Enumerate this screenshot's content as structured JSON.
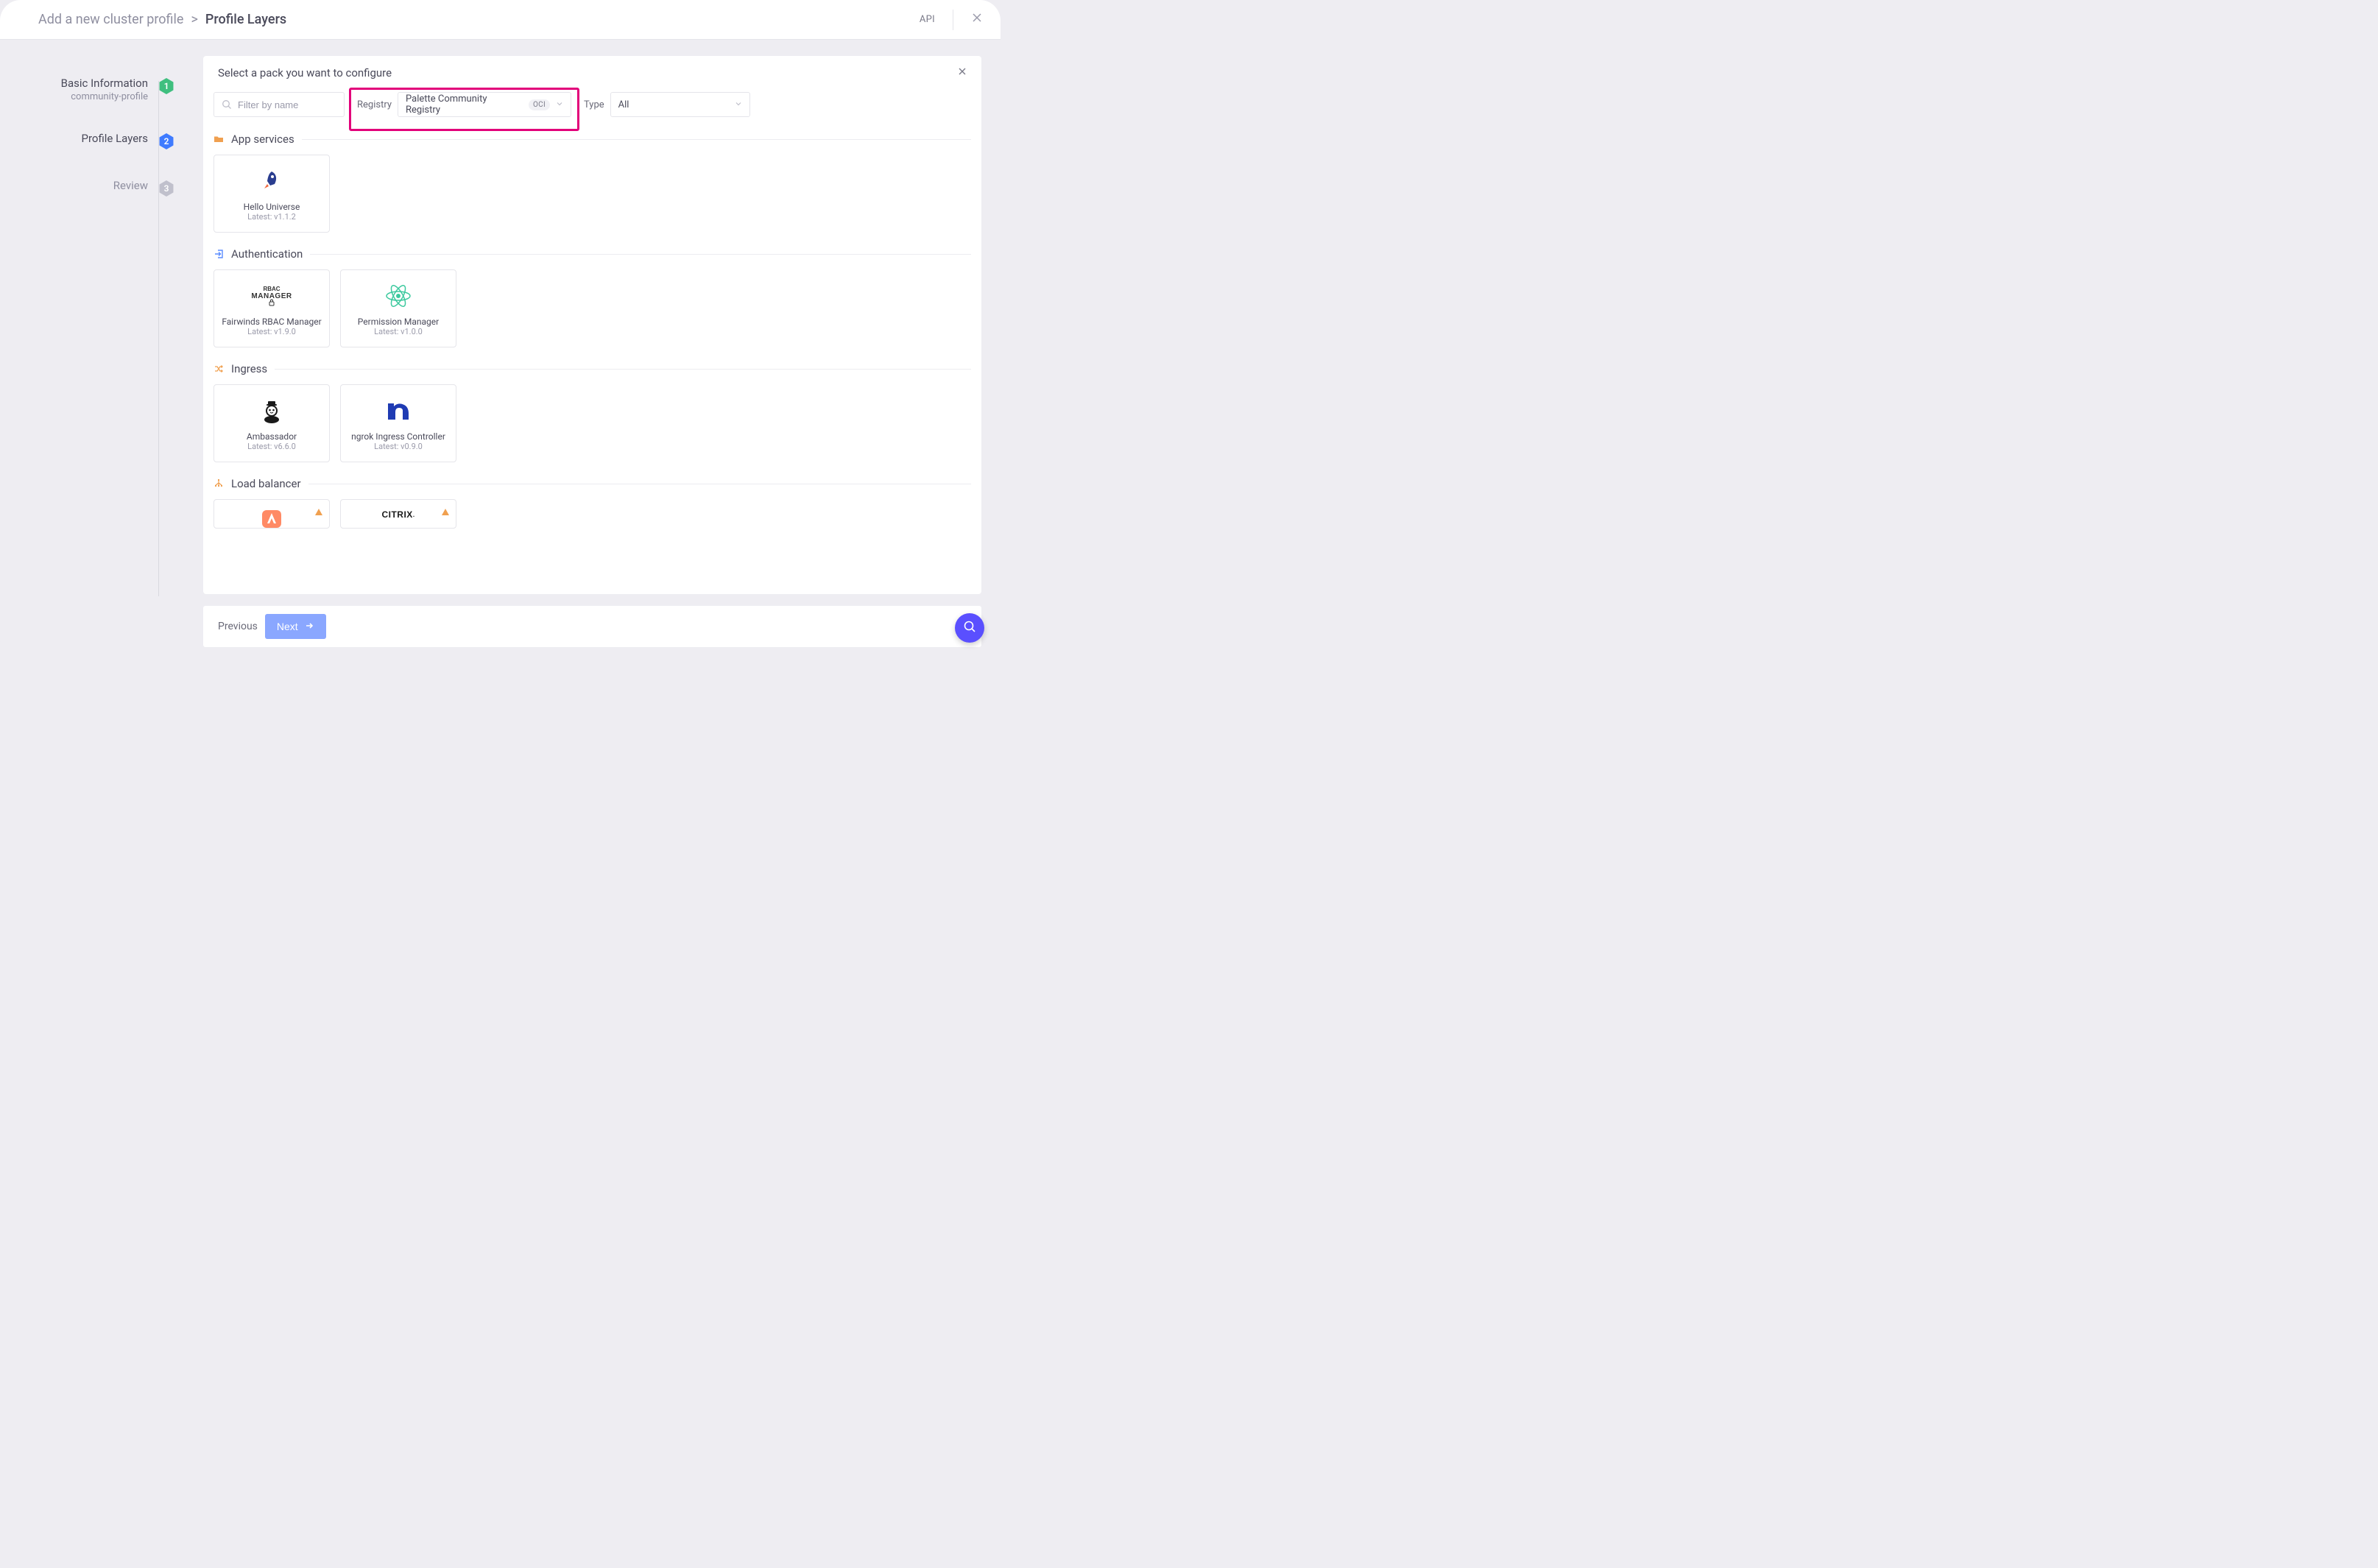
{
  "header": {
    "breadcrumb_parent": "Add a new cluster profile",
    "breadcrumb_current": "Profile Layers",
    "api": "API"
  },
  "steps": [
    {
      "title": "Basic Information",
      "sub": "community-profile",
      "state": "done",
      "num": "1"
    },
    {
      "title": "Profile Layers",
      "sub": "",
      "state": "current",
      "num": "2"
    },
    {
      "title": "Review",
      "sub": "",
      "state": "future",
      "num": "3"
    }
  ],
  "panel": {
    "title": "Select a pack you want to configure",
    "search_placeholder": "Filter by name",
    "registry_label": "Registry",
    "registry_value": "Palette Community Registry",
    "registry_tag": "OCI",
    "type_label": "Type",
    "type_value": "All"
  },
  "categories": [
    {
      "id": "app-services",
      "title": "App services",
      "icon": "folder",
      "packs": [
        {
          "name": "Hello Universe",
          "version": "Latest: v1.1.2",
          "icon": "rocket"
        }
      ]
    },
    {
      "id": "authentication",
      "title": "Authentication",
      "icon": "login",
      "packs": [
        {
          "name": "Fairwinds RBAC Manager",
          "version": "Latest: v1.9.0",
          "icon": "rbac"
        },
        {
          "name": "Permission Manager",
          "version": "Latest: v1.0.0",
          "icon": "atom"
        }
      ]
    },
    {
      "id": "ingress",
      "title": "Ingress",
      "icon": "shuffle",
      "packs": [
        {
          "name": "Ambassador",
          "version": "Latest: v6.6.0",
          "icon": "ambassador"
        },
        {
          "name": "ngrok Ingress Controller",
          "version": "Latest: v0.9.0",
          "icon": "ngrok"
        }
      ]
    },
    {
      "id": "load-balancer",
      "title": "Load balancer",
      "icon": "lb",
      "packs": [
        {
          "name": "",
          "version": "",
          "icon": "avi",
          "warn": true
        },
        {
          "name": "",
          "version": "",
          "icon": "citrix",
          "warn": true
        }
      ]
    }
  ],
  "footer": {
    "previous": "Previous",
    "next": "Next"
  }
}
